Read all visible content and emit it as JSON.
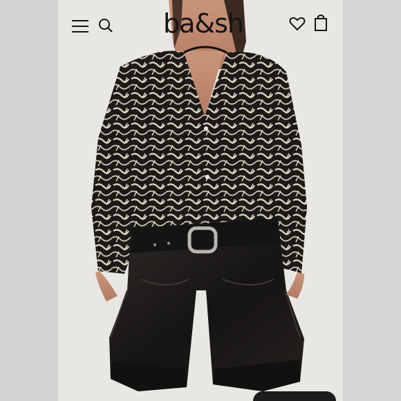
{
  "header": {
    "logo_text": "ba&sh",
    "icons": [
      "menu-icon",
      "search-icon",
      "heart-icon",
      "shopping-bag-icon"
    ]
  },
  "colors": {
    "background": "#e9e7e4",
    "text": "#141414",
    "leather": "#1d1b1a",
    "print_dark": "#1b1a17",
    "print_light": "#d8d1bf"
  }
}
